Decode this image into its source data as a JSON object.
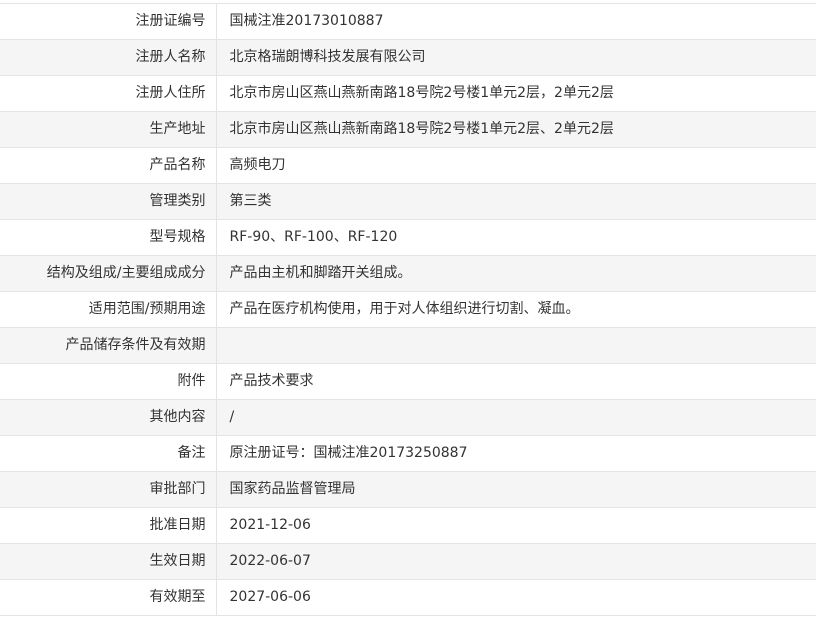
{
  "rows": [
    {
      "label": "注册证编号",
      "value": "国械注准20173010887"
    },
    {
      "label": "注册人名称",
      "value": "北京格瑞朗博科技发展有限公司"
    },
    {
      "label": "注册人住所",
      "value": "北京市房山区燕山燕新南路18号院2号楼1单元2层，2单元2层"
    },
    {
      "label": "生产地址",
      "value": "北京市房山区燕山燕新南路18号院2号楼1单元2层、2单元2层"
    },
    {
      "label": "产品名称",
      "value": "高频电刀"
    },
    {
      "label": "管理类别",
      "value": "第三类"
    },
    {
      "label": "型号规格",
      "value": "RF-90、RF-100、RF-120"
    },
    {
      "label": "结构及组成/主要组成成分",
      "value": "产品由主机和脚踏开关组成。"
    },
    {
      "label": "适用范围/预期用途",
      "value": "产品在医疗机构使用，用于对人体组织进行切割、凝血。"
    },
    {
      "label": "产品储存条件及有效期",
      "value": ""
    },
    {
      "label": "附件",
      "value": "产品技术要求"
    },
    {
      "label": "其他内容",
      "value": "/"
    },
    {
      "label": "备注",
      "value": "原注册证号：国械注准20173250887"
    },
    {
      "label": "审批部门",
      "value": "国家药品监督管理局"
    },
    {
      "label": "批准日期",
      "value": "2021-12-06"
    },
    {
      "label": "生效日期",
      "value": "2022-06-07"
    },
    {
      "label": "有效期至",
      "value": "2027-06-06"
    }
  ]
}
